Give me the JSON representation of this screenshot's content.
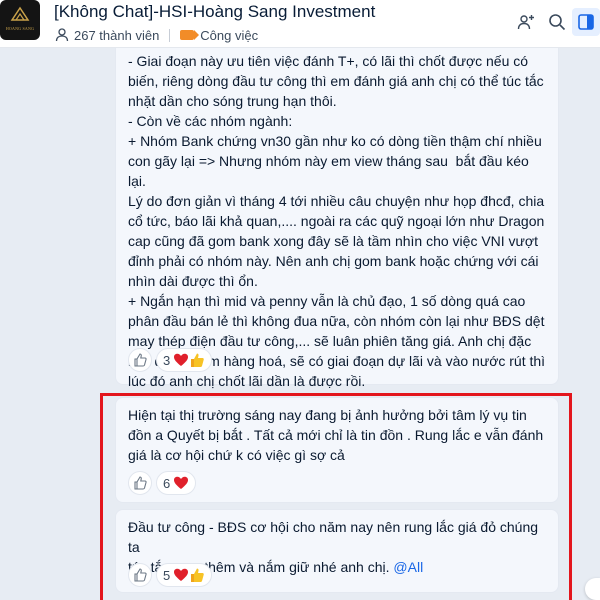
{
  "header": {
    "title": "[Không Chat]-HSI-Hoàng Sang Investment",
    "avatar_text": "HOANG SANG",
    "member_count": "267 thành viên",
    "tasks_label": "Công việc",
    "icons": [
      "add-member-icon",
      "search-icon",
      "sidebar-toggle-icon"
    ],
    "accent_color": "#1a67e6"
  },
  "messages": [
    {
      "text": "- Giai đoạn này ưu tiên việc đánh T+, có lãi thì chốt được nếu có\nbiến, riêng dòng đầu tư công thì em đánh giá anh chị có thể túc tắc\nnhặt dần cho sóng trung hạn thôi.\n- Còn về các nhóm ngành:\n+ Nhóm Bank chứng vn30 gần như ko có dòng tiền thậm chí nhiều\ncon gãy lại => Nhưng nhóm này em view tháng sau  bắt đầu kéo lại.\nLý do đơn giản vì tháng 4 tới nhiều câu chuyện như họp đhcđ, chia\ncổ tức, báo lãi khả quan,.... ngoài ra các quỹ ngoại lớn như Dragon\ncap cũng đã gom bank xong đây sẽ là tầm nhìn cho việc VNI vượt\nđỉnh phải có nhóm này. Nên anh chị gom bank hoặc chứng với cái\nnhìn dài được thì ổn.\n+ Ngắn hạn thì mid và penny vẫn là chủ đạo, 1 số dòng quá cao\nphân đầu bán lẻ thì không đua nữa, còn nhóm còn lại như BĐS dệt\nmay thép điện đầu tư công,... sẽ luân phiên tăng giá. Anh chị đặc\nbiệt để ý nhóm hàng hoá, sẽ có giai đoạn dự lãi và vào nước rút thì\nlúc đó anh chị chốt lãi dần là được rồi.",
      "reaction_count": "3",
      "reactions": [
        "heart-icon",
        "thumbs-up-icon"
      ]
    },
    {
      "text": "Hiện tại thị trường sáng nay đang bị ảnh hưởng bởi tâm lý vụ tin\nđồn a Quyết bị bắt . Tất cả mới chỉ là tin đồn . Rung lắc e vẫn đánh\ngiá là cơ hội chứ k có việc gì sợ cả",
      "reaction_count": "6",
      "reactions": [
        "heart-icon"
      ]
    },
    {
      "text": "Đầu tư công - BĐS cơ hội cho năm nay nên rung lắc giá đỏ chúng ta\ntúc tắc gom thêm và nắm giữ nhé anh chị. ",
      "mention": "@All",
      "reaction_count": "5",
      "reactions": [
        "heart-icon",
        "thumbs-up-icon"
      ]
    }
  ],
  "highlight_color": "#e3151c"
}
